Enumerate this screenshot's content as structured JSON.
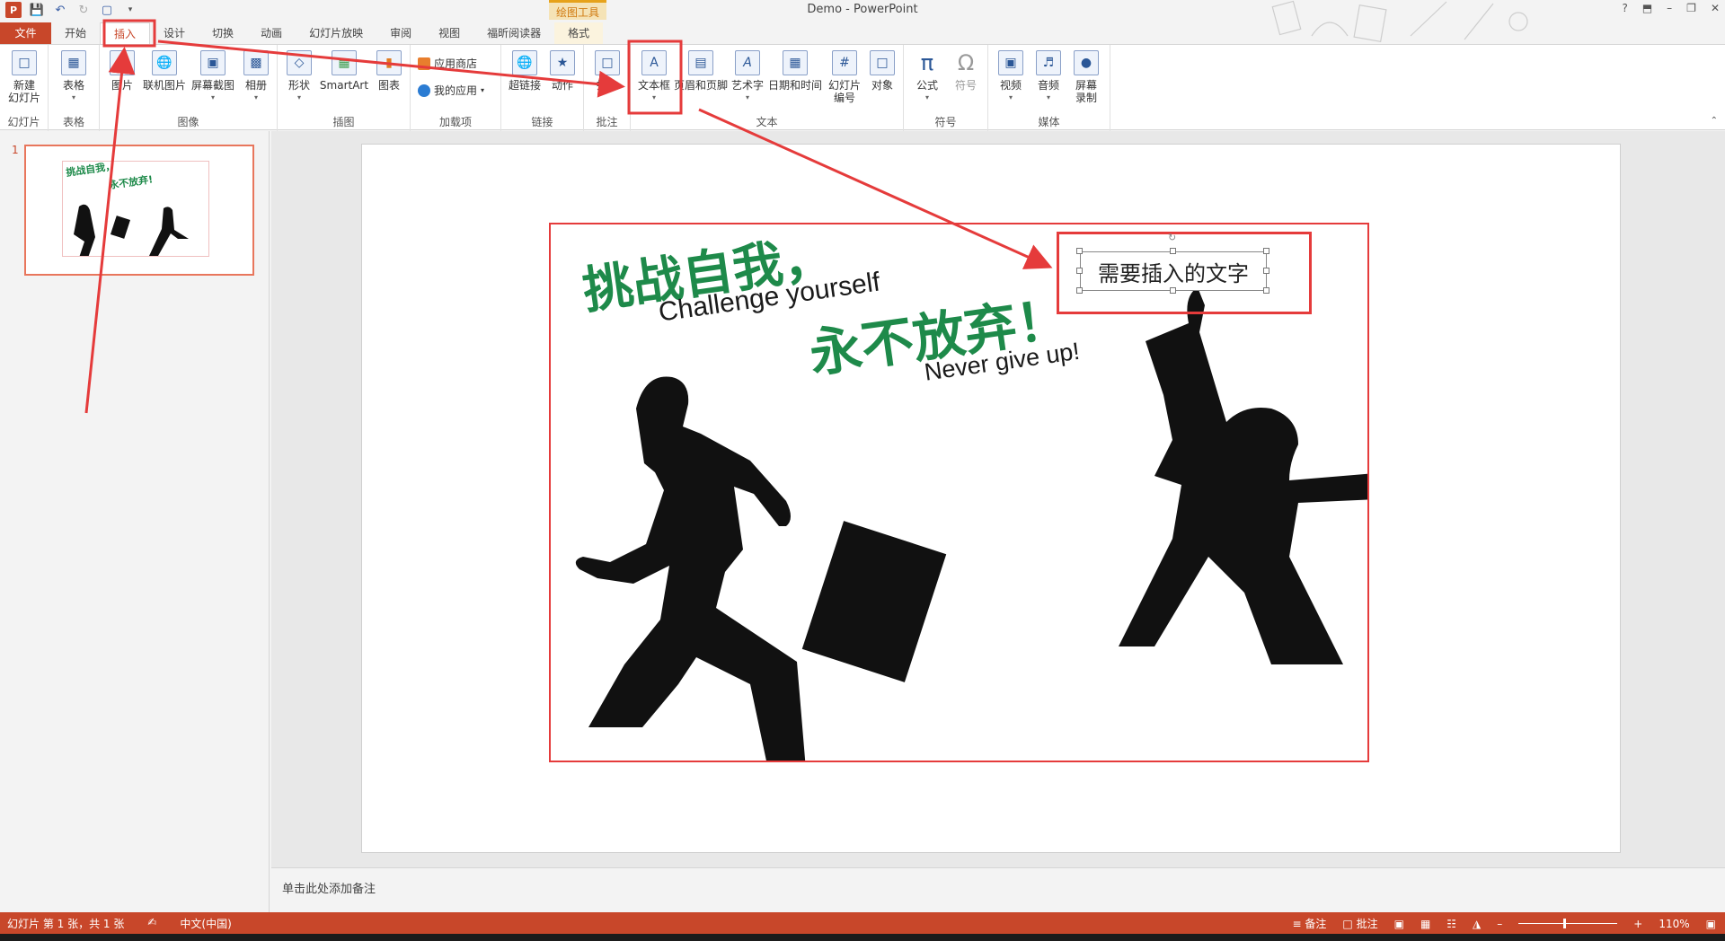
{
  "window": {
    "title": "Demo - PowerPoint",
    "contextual_tab_group": "绘图工具",
    "controls": [
      "?",
      "⬒",
      "–",
      "❐",
      "✕"
    ]
  },
  "tabs": [
    "文件",
    "开始",
    "插入",
    "设计",
    "切换",
    "动画",
    "幻灯片放映",
    "审阅",
    "视图",
    "福昕阅读器",
    "格式"
  ],
  "ribbon": {
    "groups": {
      "slides": "幻灯片",
      "tables": "表格",
      "images": "图像",
      "illustrations": "插图",
      "addins": "加载项",
      "links": "链接",
      "comments": "批注",
      "text": "文本",
      "symbols": "符号",
      "media": "媒体"
    },
    "buttons": {
      "new_slide": "新建\n幻灯片",
      "table": "表格",
      "picture": "图片",
      "online_picture": "联机图片",
      "screenshot": "屏幕截图",
      "album": "相册",
      "shapes": "形状",
      "smartart": "SmartArt",
      "chart": "图表",
      "store": "应用商店",
      "my_apps": "我的应用",
      "hyperlink": "超链接",
      "action": "动作",
      "comment": "批注",
      "textbox": "文本框",
      "header_footer": "页眉和页脚",
      "wordart": "艺术字",
      "datetime": "日期和时间",
      "slide_number": "幻灯片\n编号",
      "object": "对象",
      "equation": "公式",
      "symbol": "符号",
      "video": "视频",
      "audio": "音频",
      "screen_record": "屏幕\n录制"
    }
  },
  "thumbnail": {
    "number": "1"
  },
  "slide": {
    "slogan_cn_1": "挑战自我，",
    "slogan_en_1": "Challenge yourself",
    "slogan_cn_2": "永不放弃！",
    "slogan_en_2": "Never give up!",
    "textbox_text": "需要插入的文字"
  },
  "notes": {
    "placeholder": "单击此处添加备注"
  },
  "statusbar": {
    "slide_info": "幻灯片 第 1 张，共 1 张",
    "language": "中文(中国)",
    "notes": "备注",
    "comments": "批注",
    "zoom": "110%"
  },
  "annotation_color": "#e53b3b"
}
